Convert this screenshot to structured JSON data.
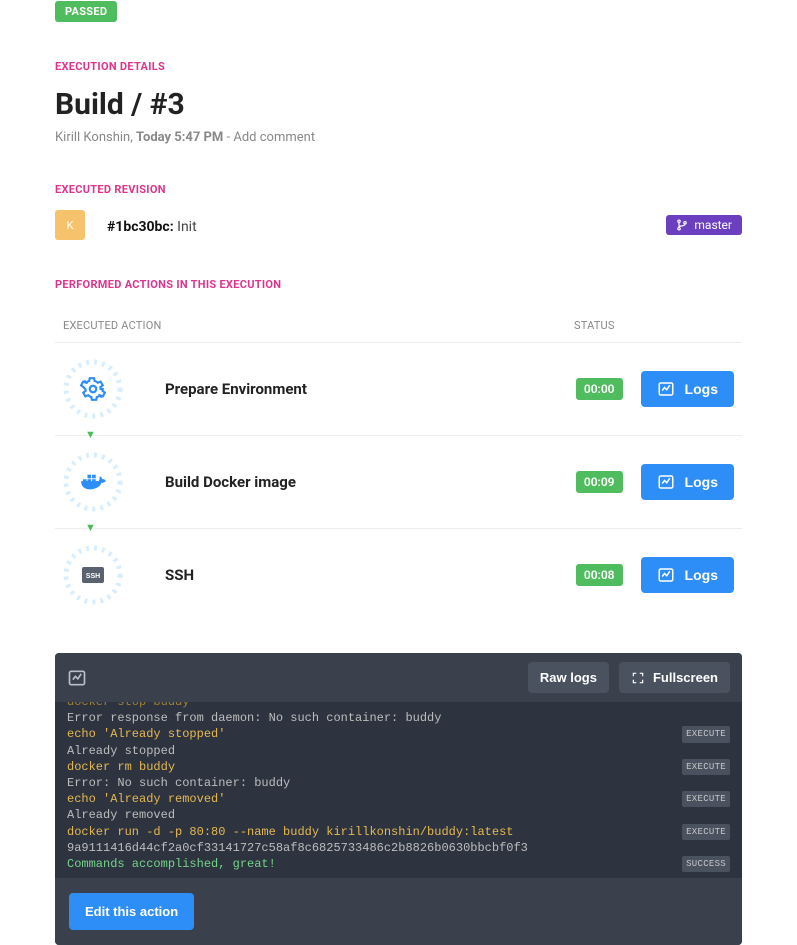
{
  "status_badge": "PASSED",
  "labels": {
    "details": "EXECUTION DETAILS",
    "revision": "EXECUTED REVISION",
    "performed": "PERFORMED ACTIONS IN THIS EXECUTION",
    "th_action": "EXECUTED ACTION",
    "th_status": "STATUS"
  },
  "title": "Build / #3",
  "meta": {
    "author": "Kirill Konshin",
    "time": "Today 5:47 PM",
    "separator1": ", ",
    "separator2": " - ",
    "add_comment": "Add comment"
  },
  "revision": {
    "avatar_letter": "K",
    "hash": "#1bc30bc:",
    "message": " Init",
    "branch": "master"
  },
  "actions": [
    {
      "name": "Prepare Environment",
      "dur": "00:00",
      "logs": "Logs",
      "icon": "gear"
    },
    {
      "name": "Build Docker image",
      "dur": "00:09",
      "logs": "Logs",
      "icon": "docker"
    },
    {
      "name": "SSH",
      "dur": "00:08",
      "logs": "Logs",
      "icon": "ssh"
    }
  ],
  "log": {
    "raw": "Raw logs",
    "fullscreen": "Fullscreen",
    "edit": "Edit this action",
    "tag_execute": "EXECUTE",
    "tag_success": "SUCCESS",
    "lines": [
      {
        "text": "docker stop buddy",
        "cls": "cut",
        "tag": ""
      },
      {
        "text": "Error response from daemon: No such container: buddy",
        "cls": "out",
        "tag": ""
      },
      {
        "text": "echo 'Already stopped'",
        "cls": "cmd",
        "tag": "EXECUTE"
      },
      {
        "text": "Already stopped",
        "cls": "out",
        "tag": ""
      },
      {
        "text": "docker rm buddy",
        "cls": "cmd",
        "tag": "EXECUTE"
      },
      {
        "text": "Error: No such container: buddy",
        "cls": "out",
        "tag": ""
      },
      {
        "text": "echo 'Already removed'",
        "cls": "cmd",
        "tag": "EXECUTE"
      },
      {
        "text": "Already removed",
        "cls": "out",
        "tag": ""
      },
      {
        "text": "docker run -d -p 80:80 --name buddy kirillkonshin/buddy:latest",
        "cls": "cmd",
        "tag": "EXECUTE"
      },
      {
        "text": "9a9111416d44cf2a0cf33141727c58af8c6825733486c2b8826b0630bbcbf0f3",
        "cls": "out",
        "tag": ""
      },
      {
        "text": "Commands accomplished, great!",
        "cls": "succ",
        "tag": "SUCCESS"
      }
    ]
  }
}
